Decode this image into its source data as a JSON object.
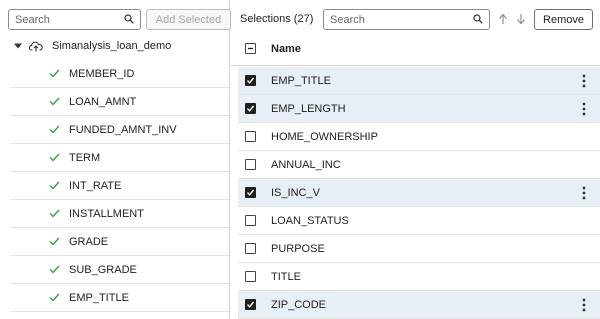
{
  "left_panel": {
    "search_placeholder": "Search",
    "add_selected_label": "Add Selected",
    "root": {
      "label": "Simanalysis_loan_demo",
      "expanded": true
    },
    "items": [
      {
        "label": "MEMBER_ID"
      },
      {
        "label": "LOAN_AMNT"
      },
      {
        "label": "FUNDED_AMNT_INV"
      },
      {
        "label": "TERM"
      },
      {
        "label": "INT_RATE"
      },
      {
        "label": "INSTALLMENT"
      },
      {
        "label": "GRADE"
      },
      {
        "label": "SUB_GRADE"
      },
      {
        "label": "EMP_TITLE"
      }
    ]
  },
  "right_panel": {
    "selections_label": "Selections (27)",
    "search_placeholder": "Search",
    "remove_label": "Remove",
    "header": {
      "label": "Name"
    },
    "rows": [
      {
        "label": "EMP_TITLE",
        "checked": true
      },
      {
        "label": "EMP_LENGTH",
        "checked": true
      },
      {
        "label": "HOME_OWNERSHIP",
        "checked": false
      },
      {
        "label": "ANNUAL_INC",
        "checked": false
      },
      {
        "label": "IS_INC_V",
        "checked": true
      },
      {
        "label": "LOAN_STATUS",
        "checked": false
      },
      {
        "label": "PURPOSE",
        "checked": false
      },
      {
        "label": "TITLE",
        "checked": false
      },
      {
        "label": "ZIP_CODE",
        "checked": true
      }
    ]
  },
  "colors": {
    "check_green": "#3d9a4a",
    "selected_row": "#e7eef6"
  }
}
